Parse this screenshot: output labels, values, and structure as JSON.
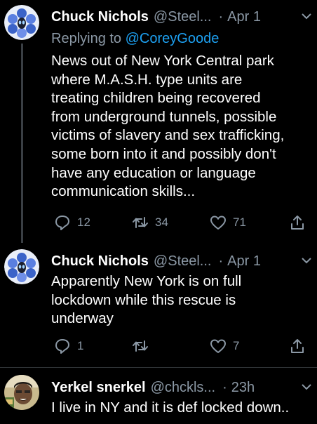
{
  "tweets": [
    {
      "name": "Chuck Nichols",
      "handle": "@Steel...",
      "time": "Apr 1",
      "reply_prefix": "Replying to ",
      "reply_mention": "@CoreyGoode",
      "text": "News out of New York Central park\nwhere M.A.S.H. type units are\ntreating children being recovered\nfrom underground tunnels, possible\nvictims of slavery and sex trafficking,\nsome born into it and possibly don't\nhave any education or language\ncommunication skills...",
      "replies": "12",
      "retweets": "34",
      "likes": "71",
      "icons": [
        "reply-icon",
        "retweet-icon",
        "like-icon",
        "share-icon"
      ]
    },
    {
      "name": "Chuck Nichols",
      "handle": "@Steel...",
      "time": "Apr 1",
      "text": "Apparently New York is on full\nlockdown while this rescue is\nunderway",
      "replies": "1",
      "retweets": "",
      "likes": "7",
      "icons": [
        "reply-icon",
        "retweet-icon",
        "like-icon",
        "share-icon"
      ]
    },
    {
      "name": "Yerkel snerkel",
      "handle": "@chckls...",
      "time": "23h",
      "text": "I live in NY and it is def locked down.."
    }
  ],
  "colors": {
    "background": "#000000",
    "text": "#ffffff",
    "secondary": "#8b98a5",
    "link": "#1da1f2",
    "thread_line": "#3a3f44"
  }
}
